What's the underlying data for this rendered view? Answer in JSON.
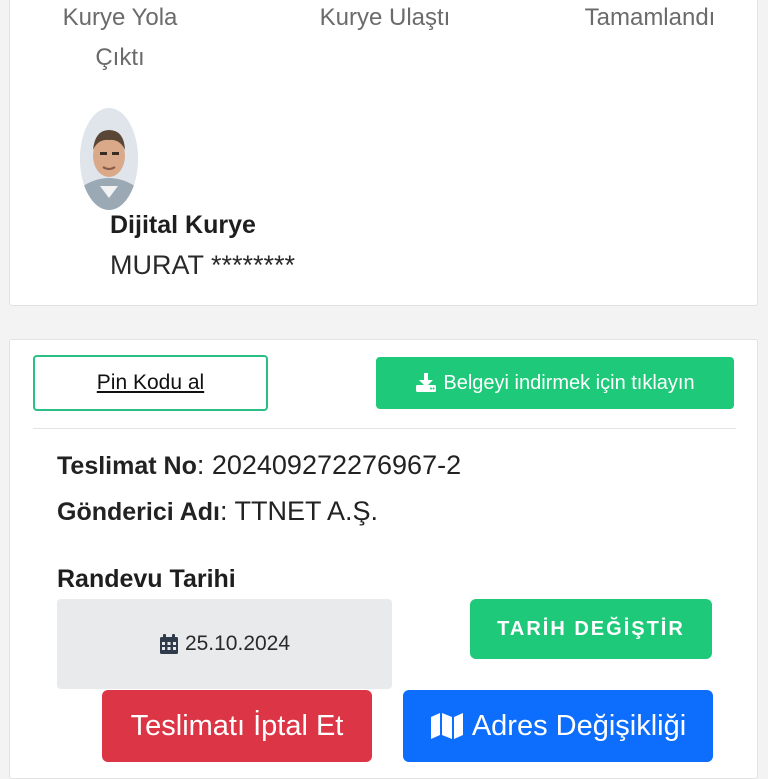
{
  "progress": {
    "step_on_the_way": "Kurye Yola Çıktı",
    "step_arrived": "Kurye Ulaştı",
    "step_completed": "Tamamlandı"
  },
  "courier": {
    "title": "Dijital Kurye",
    "name": "MURAT ********"
  },
  "actions": {
    "pin_label": "Pin Kodu al",
    "download_label": "Belgeyi indirmek için tıklayın"
  },
  "delivery": {
    "teslimat_label": "Teslimat No",
    "teslimat_value": ": 202409272276967-2",
    "gonderici_label": "Gönderici Adı",
    "gonderici_value": ": TTNET A.Ş."
  },
  "appointment": {
    "label": "Randevu Tarihi",
    "date": "25.10.2024",
    "change_label": "TARİH DEĞİŞTİR"
  },
  "bottom_actions": {
    "cancel_label": "Teslimatı İptal Et",
    "address_label": "Adres Değişikliği"
  },
  "colors": {
    "green": "#1fc97a",
    "red": "#dc3545",
    "blue": "#0d6efd"
  },
  "icons": [
    "download-icon",
    "calendar-icon",
    "map-icon"
  ]
}
